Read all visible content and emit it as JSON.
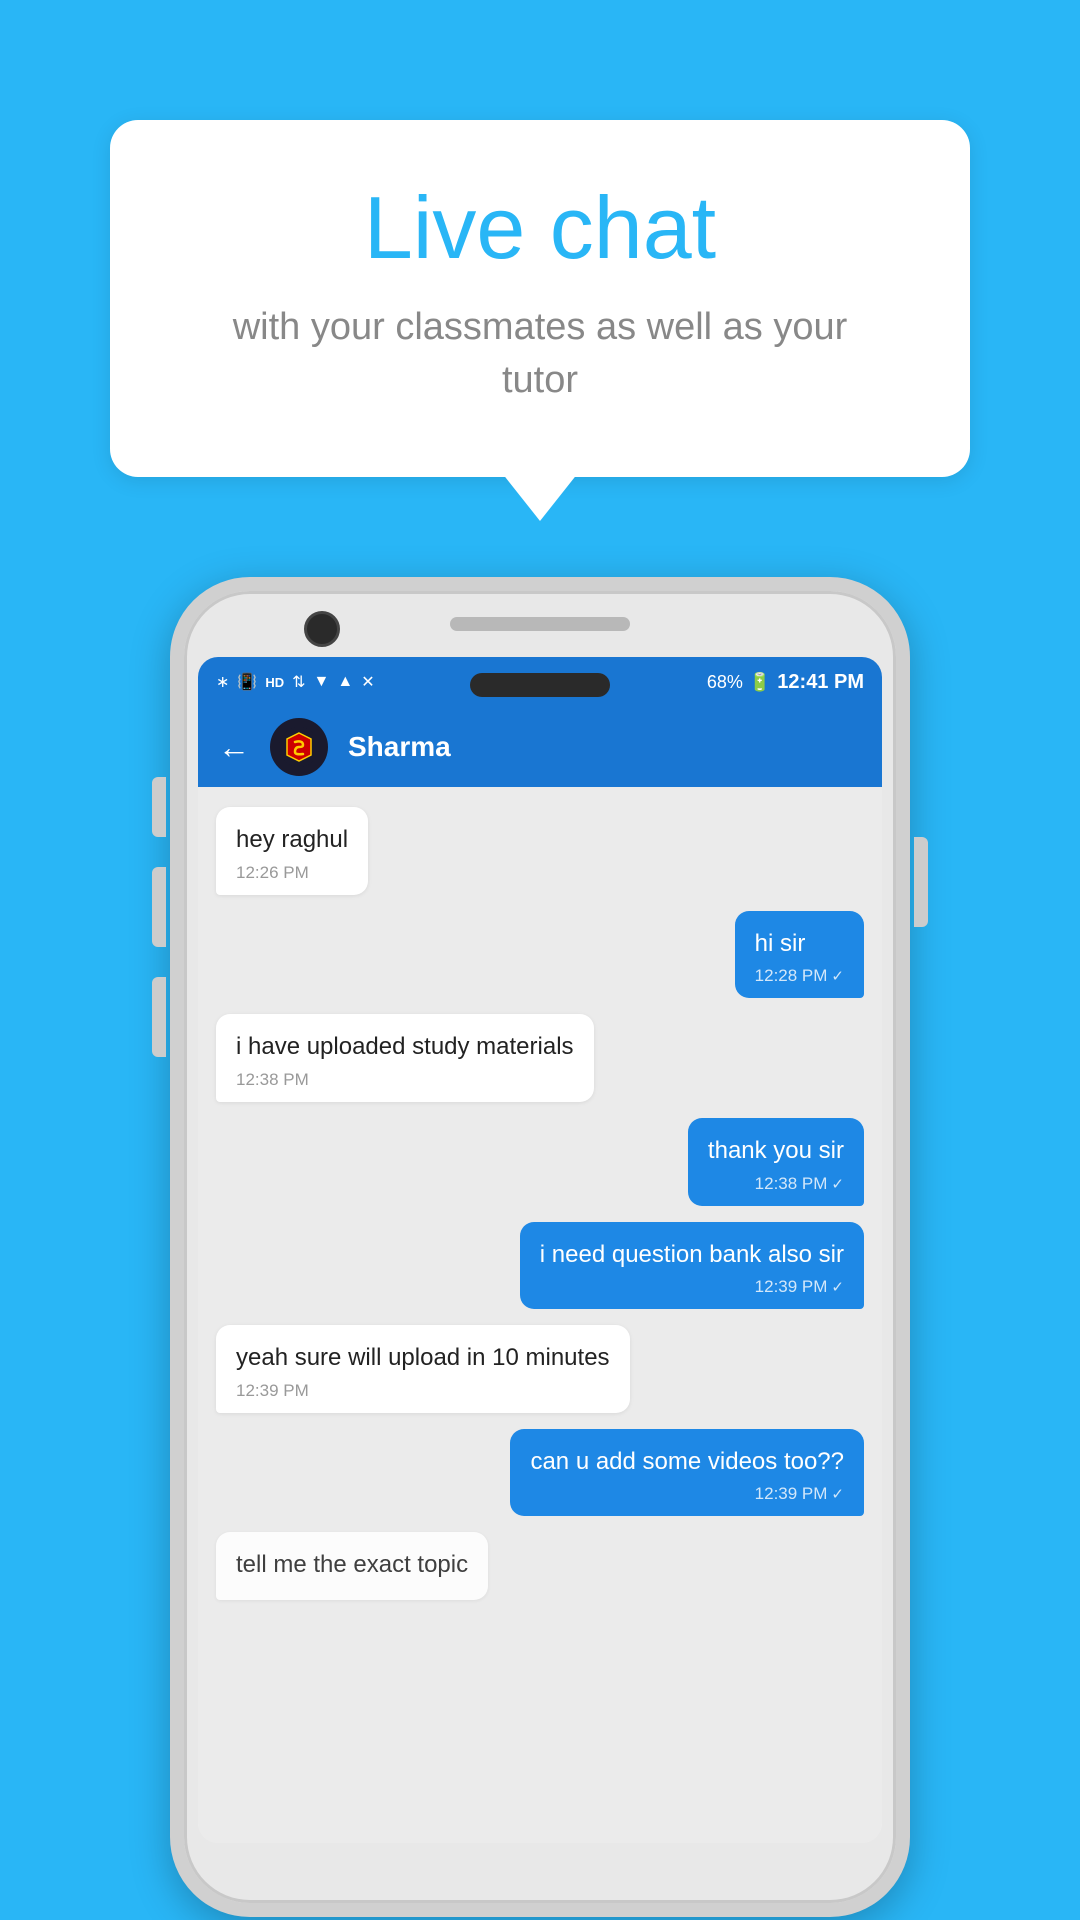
{
  "background_color": "#29B6F6",
  "tooltip": {
    "title": "Live chat",
    "subtitle": "with your classmates as well as your tutor"
  },
  "phone": {
    "status_bar": {
      "time": "12:41 PM",
      "battery": "68%",
      "icons": [
        "bluetooth",
        "vibrate",
        "hd",
        "wifi",
        "signal",
        "signal-x",
        "signal-x2"
      ]
    },
    "toolbar": {
      "contact_name": "Sharma",
      "back_label": "←"
    },
    "messages": [
      {
        "id": 1,
        "type": "received",
        "text": "hey raghul",
        "time": "12:26 PM",
        "check": false
      },
      {
        "id": 2,
        "type": "sent",
        "text": "hi sir",
        "time": "12:28 PM",
        "check": true
      },
      {
        "id": 3,
        "type": "received",
        "text": "i have uploaded study materials",
        "time": "12:38 PM",
        "check": false
      },
      {
        "id": 4,
        "type": "sent",
        "text": "thank you sir",
        "time": "12:38 PM",
        "check": true
      },
      {
        "id": 5,
        "type": "sent",
        "text": "i need question bank also sir",
        "time": "12:39 PM",
        "check": true
      },
      {
        "id": 6,
        "type": "received",
        "text": "yeah sure will upload in 10 minutes",
        "time": "12:39 PM",
        "check": false
      },
      {
        "id": 7,
        "type": "sent",
        "text": "can u add some videos too??",
        "time": "12:39 PM",
        "check": true
      },
      {
        "id": 8,
        "type": "received",
        "text": "tell me the exact topic",
        "time": "",
        "partial": true
      }
    ]
  }
}
